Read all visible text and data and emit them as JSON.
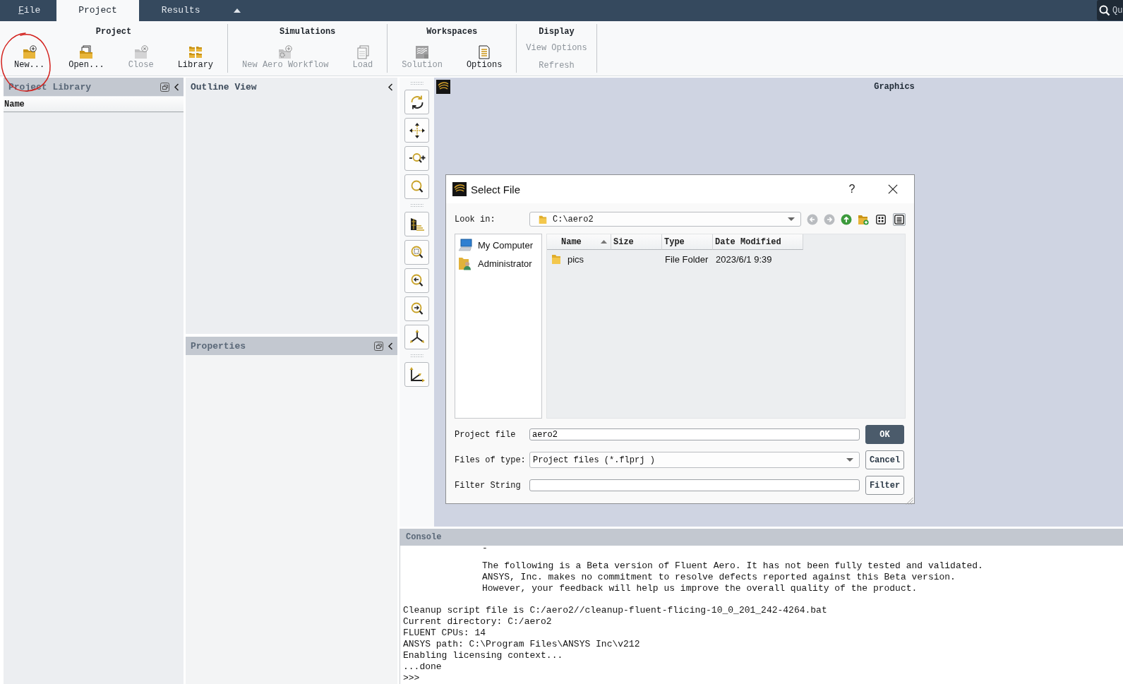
{
  "menu_tabs": [
    {
      "label": "File",
      "selected": false,
      "access_key": true
    },
    {
      "label": "Project",
      "selected": true,
      "access_key": false
    },
    {
      "label": "Results",
      "selected": false,
      "access_key": false
    }
  ],
  "quick_search": {
    "placeholder": "Qu"
  },
  "ribbon": {
    "groups": [
      {
        "title": "Project",
        "buttons": [
          {
            "label": "New...",
            "kind": "large",
            "disabled": false
          },
          {
            "label": "Open...",
            "kind": "large",
            "disabled": false
          },
          {
            "label": "Close",
            "kind": "large",
            "disabled": true
          },
          {
            "label": "Library",
            "kind": "large",
            "disabled": false
          }
        ]
      },
      {
        "title": "Simulations",
        "buttons": [
          {
            "label": "New Aero Workflow",
            "kind": "large",
            "disabled": true
          },
          {
            "label": "Load",
            "kind": "large",
            "disabled": true
          }
        ]
      },
      {
        "title": "Workspaces",
        "buttons": [
          {
            "label": "Solution",
            "kind": "large",
            "disabled": true
          },
          {
            "label": "Options",
            "kind": "large",
            "disabled": false
          }
        ]
      },
      {
        "title": "Display",
        "buttons": [
          {
            "label": "View Options",
            "kind": "text",
            "disabled": true
          },
          {
            "label": "Refresh",
            "kind": "text",
            "disabled": true
          }
        ]
      }
    ]
  },
  "project_library": {
    "title": "Project Library",
    "column": "Name"
  },
  "outline_view": {
    "title": "Outline View"
  },
  "properties": {
    "title": "Properties"
  },
  "graphics": {
    "title": "Graphics"
  },
  "dialog": {
    "title": "Select File",
    "help": "?",
    "look_in": {
      "label": "Look in:",
      "value": "C:\\aero2"
    },
    "nav_buttons": [
      {
        "kind": "back",
        "disabled": true
      },
      {
        "kind": "forward",
        "disabled": true
      },
      {
        "kind": "up",
        "disabled": false
      },
      {
        "kind": "new_folder",
        "disabled": false
      }
    ],
    "view_buttons": [
      {
        "kind": "list",
        "selected": false
      },
      {
        "kind": "detail",
        "selected": true
      }
    ],
    "places": [
      {
        "label": "My Computer",
        "kind": "computer"
      },
      {
        "label": "Administrator",
        "kind": "user"
      }
    ],
    "file_list": {
      "columns": [
        {
          "label": "Name",
          "sorted": true
        },
        {
          "label": "Size",
          "sorted": false
        },
        {
          "label": "Type",
          "sorted": false
        },
        {
          "label": "Date Modified",
          "sorted": false
        }
      ],
      "rows": [
        {
          "name": "pics",
          "type": "File Folder",
          "date_modified": "2023/6/1 9:39"
        }
      ]
    },
    "form_rows": [
      {
        "label": "Project file",
        "kind": "input",
        "value": "aero2",
        "button": {
          "label": "OK",
          "primary": true
        }
      },
      {
        "label": "Files of type:",
        "kind": "dropdown",
        "value": "Project files (*.flprj )",
        "button": {
          "label": "Cancel",
          "primary": false
        }
      },
      {
        "label": "Filter String",
        "kind": "input",
        "button": {
          "label": "Filter",
          "primary": false
        }
      }
    ]
  },
  "console": {
    "title": "Console",
    "notice": [
      "-",
      "The following is a Beta version of Fluent Aero. It has not been fully tested and validated.",
      "ANSYS, Inc. makes no commitment to resolve defects reported against this Beta version.",
      "However, your feedback will help us improve the overall quality of the product."
    ],
    "log": [
      "Cleanup script file is C:/aero2//cleanup-fluent-flicing-10_0_201_242-4264.bat",
      "Current directory: C:/aero2",
      "FLUENT CPUs: 14",
      "ANSYS path: C:\\Program Files\\ANSYS Inc\\v212",
      "Enabling licensing context...",
      "...done",
      ">>>"
    ]
  }
}
